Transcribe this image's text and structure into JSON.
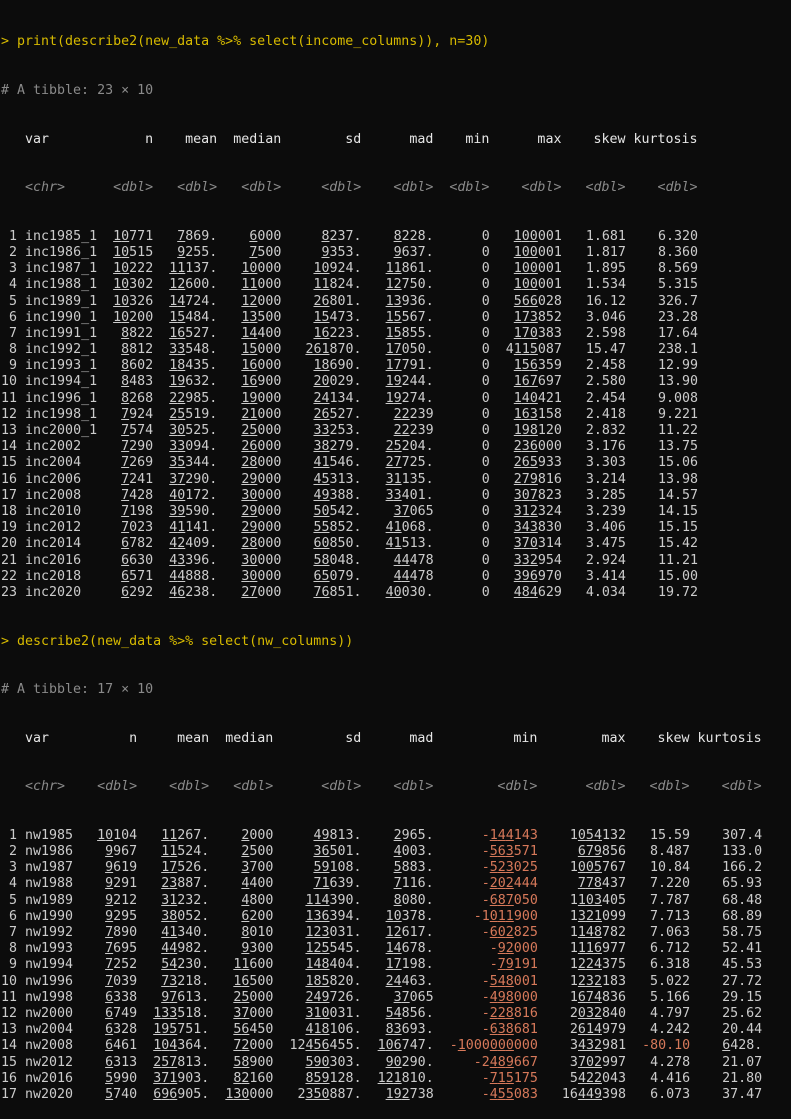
{
  "commands": [
    "> print(describe2(new_data %>% select(income_columns)), n=30)",
    "> describe2(new_data %>% select(nw_columns))"
  ],
  "tables": [
    {
      "meta": "# A tibble: 23 × 10",
      "columns": [
        "var",
        "n",
        "mean",
        "median",
        "sd",
        "mad",
        "min",
        "max",
        "skew",
        "kurtosis"
      ],
      "types": [
        "<chr>",
        "<dbl>",
        "<dbl>",
        "<dbl>",
        "<dbl>",
        "<dbl>",
        "<dbl>",
        "<dbl>",
        "<dbl>",
        "<dbl>"
      ],
      "rows": [
        [
          "1",
          "inc1985_1",
          "10771",
          "7869.",
          "6000",
          "8237.",
          "8228.",
          "0",
          "100001",
          "1.681",
          "6.320"
        ],
        [
          "2",
          "inc1986_1",
          "10515",
          "9255.",
          "7500",
          "9353.",
          "9637.",
          "0",
          "100001",
          "1.817",
          "8.360"
        ],
        [
          "3",
          "inc1987_1",
          "10222",
          "11137.",
          "10000",
          "10924.",
          "11861.",
          "0",
          "100001",
          "1.895",
          "8.569"
        ],
        [
          "4",
          "inc1988_1",
          "10302",
          "12600.",
          "11000",
          "11824.",
          "12750.",
          "0",
          "100001",
          "1.534",
          "5.315"
        ],
        [
          "5",
          "inc1989_1",
          "10326",
          "14724.",
          "12000",
          "26801.",
          "13936.",
          "0",
          "566028",
          "16.12",
          "326.7"
        ],
        [
          "6",
          "inc1990_1",
          "10200",
          "15484.",
          "13500",
          "15473.",
          "15567.",
          "0",
          "173852",
          "3.046",
          "23.28"
        ],
        [
          "7",
          "inc1991_1",
          "8822",
          "16527.",
          "14400",
          "16223.",
          "15855.",
          "0",
          "170383",
          "2.598",
          "17.64"
        ],
        [
          "8",
          "inc1992_1",
          "8812",
          "33548.",
          "15000",
          "261870.",
          "17050.",
          "0",
          "4115087",
          "15.47",
          "238.1"
        ],
        [
          "9",
          "inc1993_1",
          "8602",
          "18435.",
          "16000",
          "18690.",
          "17791.",
          "0",
          "156359",
          "2.458",
          "12.99"
        ],
        [
          "10",
          "inc1994_1",
          "8483",
          "19632.",
          "16900",
          "20029.",
          "19244.",
          "0",
          "167697",
          "2.580",
          "13.90"
        ],
        [
          "11",
          "inc1996_1",
          "8268",
          "22985.",
          "19000",
          "24134.",
          "19274.",
          "0",
          "140421",
          "2.454",
          "9.008"
        ],
        [
          "12",
          "inc1998_1",
          "7924",
          "25519.",
          "21000",
          "26527.",
          "22239",
          "0",
          "163158",
          "2.418",
          "9.221"
        ],
        [
          "13",
          "inc2000_1",
          "7574",
          "30525.",
          "25000",
          "33253.",
          "22239",
          "0",
          "198120",
          "2.832",
          "11.22"
        ],
        [
          "14",
          "inc2002",
          "7290",
          "33094.",
          "26000",
          "38279.",
          "25204.",
          "0",
          "236000",
          "3.176",
          "13.75"
        ],
        [
          "15",
          "inc2004",
          "7269",
          "35344.",
          "28000",
          "41546.",
          "27725.",
          "0",
          "265933",
          "3.303",
          "15.06"
        ],
        [
          "16",
          "inc2006",
          "7241",
          "37290.",
          "29000",
          "45313.",
          "31135.",
          "0",
          "279816",
          "3.214",
          "13.98"
        ],
        [
          "17",
          "inc2008",
          "7428",
          "40172.",
          "30000",
          "49388.",
          "33401.",
          "0",
          "307823",
          "3.285",
          "14.57"
        ],
        [
          "18",
          "inc2010",
          "7198",
          "39590.",
          "29000",
          "50542.",
          "37065",
          "0",
          "312324",
          "3.239",
          "14.15"
        ],
        [
          "19",
          "inc2012",
          "7023",
          "41141.",
          "29000",
          "55852.",
          "41068.",
          "0",
          "343830",
          "3.406",
          "15.15"
        ],
        [
          "20",
          "inc2014",
          "6782",
          "42409.",
          "28000",
          "60850.",
          "41513.",
          "0",
          "370314",
          "3.475",
          "15.42"
        ],
        [
          "21",
          "inc2016",
          "6630",
          "43396.",
          "30000",
          "58048.",
          "44478",
          "0",
          "332954",
          "2.924",
          "11.21"
        ],
        [
          "22",
          "inc2018",
          "6571",
          "44888.",
          "30000",
          "65079.",
          "44478",
          "0",
          "396970",
          "3.414",
          "15.00"
        ],
        [
          "23",
          "inc2020",
          "6292",
          "46238.",
          "27000",
          "76851.",
          "40030.",
          "0",
          "484629",
          "4.034",
          "19.72"
        ]
      ]
    },
    {
      "meta": "# A tibble: 17 × 10",
      "columns": [
        "var",
        "n",
        "mean",
        "median",
        "sd",
        "mad",
        "min",
        "max",
        "skew",
        "kurtosis"
      ],
      "types": [
        "<chr>",
        "<dbl>",
        "<dbl>",
        "<dbl>",
        "<dbl>",
        "<dbl>",
        "<dbl>",
        "<dbl>",
        "<dbl>",
        "<dbl>"
      ],
      "rows": [
        [
          "1",
          "nw1985",
          "10104",
          "11267.",
          "2000",
          "49813.",
          "2965.",
          "-144143",
          "1054132",
          "15.59",
          "307.4"
        ],
        [
          "2",
          "nw1986",
          "9967",
          "11524.",
          "2500",
          "36501.",
          "4003.",
          "-563571",
          "679856",
          "8.487",
          "133.0"
        ],
        [
          "3",
          "nw1987",
          "9619",
          "17526.",
          "3700",
          "59108.",
          "5883.",
          "-523025",
          "1005767",
          "10.84",
          "166.2"
        ],
        [
          "4",
          "nw1988",
          "9291",
          "23887.",
          "4400",
          "71639.",
          "7116.",
          "-202444",
          "778437",
          "7.220",
          "65.93"
        ],
        [
          "5",
          "nw1989",
          "9212",
          "31232.",
          "4800",
          "114390.",
          "8080.",
          "-687050",
          "1103405",
          "7.787",
          "68.48"
        ],
        [
          "6",
          "nw1990",
          "9295",
          "38052.",
          "6200",
          "136394.",
          "10378.",
          "-1011900",
          "1321099",
          "7.713",
          "68.89"
        ],
        [
          "7",
          "nw1992",
          "7890",
          "41340.",
          "8010",
          "123031.",
          "12617.",
          "-602825",
          "1148782",
          "7.063",
          "58.75"
        ],
        [
          "8",
          "nw1993",
          "7695",
          "44982.",
          "9300",
          "125545.",
          "14678.",
          "-92000",
          "1116977",
          "6.712",
          "52.41"
        ],
        [
          "9",
          "nw1994",
          "7252",
          "54230.",
          "11600",
          "148404.",
          "17198.",
          "-79191",
          "1224375",
          "6.318",
          "45.53"
        ],
        [
          "10",
          "nw1996",
          "7039",
          "73218.",
          "16500",
          "185820.",
          "24463.",
          "-548001",
          "1232183",
          "5.022",
          "27.72"
        ],
        [
          "11",
          "nw1998",
          "6338",
          "97613.",
          "25000",
          "249726.",
          "37065",
          "-498000",
          "1674836",
          "5.166",
          "29.15"
        ],
        [
          "12",
          "nw2000",
          "6749",
          "133518.",
          "37000",
          "310031.",
          "54856.",
          "-228816",
          "2032840",
          "4.797",
          "25.62"
        ],
        [
          "13",
          "nw2004",
          "6328",
          "195751.",
          "56450",
          "418106.",
          "83693.",
          "-638681",
          "2614979",
          "4.242",
          "20.44"
        ],
        [
          "14",
          "nw2008",
          "6461",
          "104364.",
          "72000",
          "12456455.",
          "106747.",
          "-1000000000",
          "3432981",
          "-80.10",
          "6428."
        ],
        [
          "15",
          "nw2012",
          "6313",
          "257813.",
          "58900",
          "590303.",
          "90290.",
          "-2489667",
          "3702997",
          "4.278",
          "21.07"
        ],
        [
          "16",
          "nw2016",
          "5990",
          "371903.",
          "82160",
          "859128.",
          "121810.",
          "-715175",
          "5422043",
          "4.416",
          "21.80"
        ],
        [
          "17",
          "nw2020",
          "5740",
          "696905.",
          "130000",
          "2350887.",
          "192738",
          "-455083",
          "16449398",
          "6.073",
          "37.47"
        ]
      ]
    }
  ]
}
